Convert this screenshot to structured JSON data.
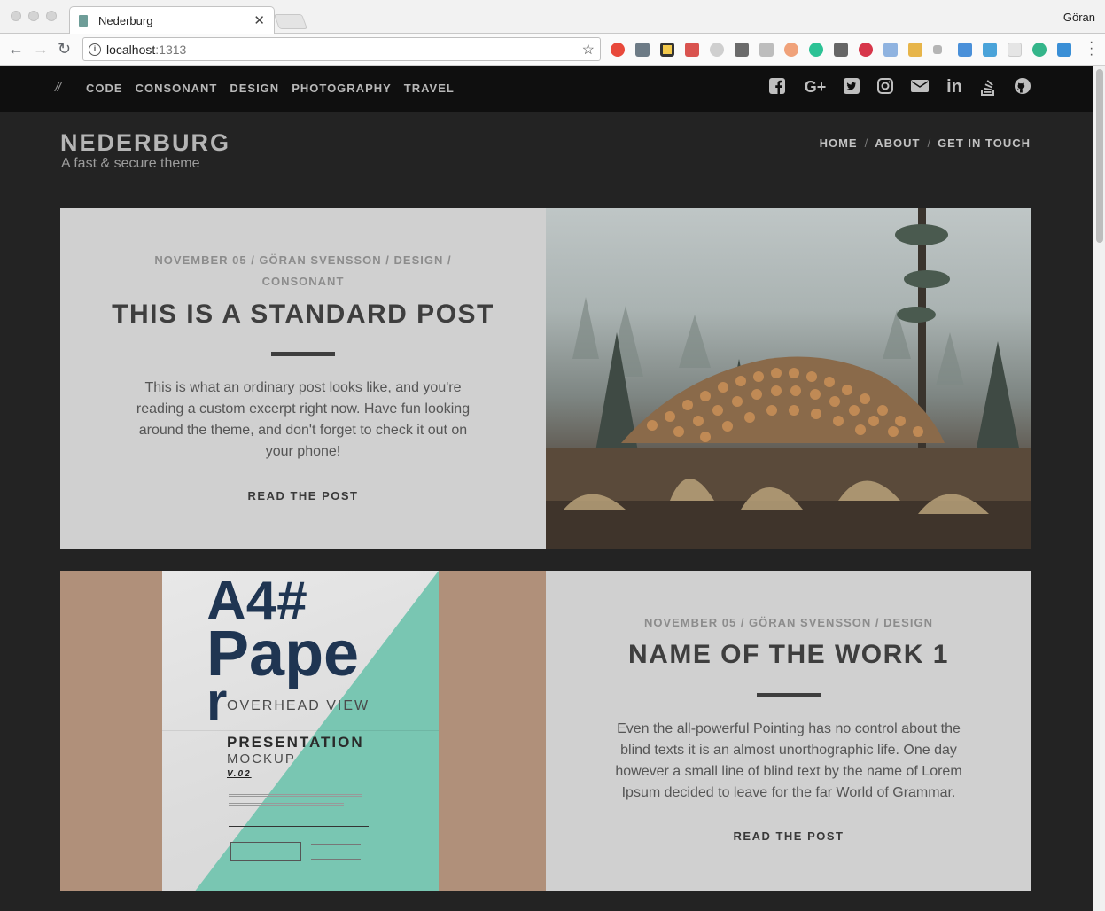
{
  "browser": {
    "tab_title": "Nederburg",
    "url_host": "localhost",
    "url_port": ":1313",
    "profile_name": "Göran"
  },
  "site": {
    "topnav": [
      "CODE",
      "CONSONANT",
      "DESIGN",
      "PHOTOGRAPHY",
      "TRAVEL"
    ],
    "slashes": "//",
    "social_icons": [
      "facebook-icon",
      "google-plus-icon",
      "twitter-icon",
      "instagram-icon",
      "mail-icon",
      "linkedin-icon",
      "stackoverflow-icon",
      "github-icon"
    ],
    "brand": "NEDERBURG",
    "tagline": "A fast & secure theme",
    "mainnav": [
      "HOME",
      "ABOUT",
      "GET IN TOUCH"
    ],
    "mainnav_sep": "/"
  },
  "posts": [
    {
      "meta_line1": "NOVEMBER 05 / GÖRAN SVENSSON / DESIGN /",
      "meta_line2": "CONSONANT",
      "title": "THIS IS A STANDARD POST",
      "excerpt": "This is what an ordinary post looks like, and you're reading a custom excerpt right now. Have fun looking around the theme, and don't forget to check it out on your phone!",
      "read_more": "READ THE POST"
    },
    {
      "meta_line1": "NOVEMBER 05 / GÖRAN SVENSSON / DESIGN",
      "title": "NAME OF THE WORK 1",
      "excerpt": "Even the all-powerful Pointing has no control about the blind texts it is an almost unorthographic life. One day however a small line of blind text by the name of Lorem Ipsum decided to leave for the far World of Grammar.",
      "read_more": "READ THE POST"
    }
  ],
  "mockup": {
    "line1": "A4#",
    "line2": "Pape",
    "line3": "r",
    "overhead": "OVERHEAD VIEW",
    "presentation": "PRESENTATION",
    "mockup_word": "MOCKUP",
    "version": "V.02"
  },
  "colors": {
    "page_bg": "#232323",
    "topbar_bg": "#0f0f0f",
    "card_bg": "#d0d0d0",
    "mint": "#79c6b2",
    "paper_navy": "#1f3552"
  }
}
